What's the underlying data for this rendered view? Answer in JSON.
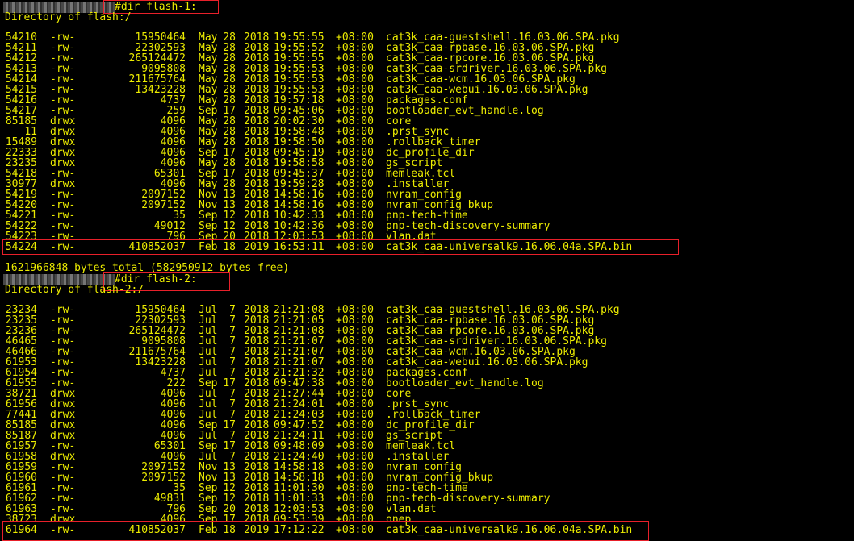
{
  "colors": {
    "background": "#000000",
    "text": "#ecec00",
    "highlight": "#e8202a"
  },
  "block1": {
    "command": "#dir flash-1:",
    "directory": "Directory of flash:/",
    "rows": [
      [
        "54210",
        "-rw-",
        "15950464",
        "May",
        "28",
        "2018",
        "19:55:55",
        "+08:00",
        "cat3k_caa-guestshell.16.03.06.SPA.pkg"
      ],
      [
        "54211",
        "-rw-",
        "22302593",
        "May",
        "28",
        "2018",
        "19:55:52",
        "+08:00",
        "cat3k_caa-rpbase.16.03.06.SPA.pkg"
      ],
      [
        "54212",
        "-rw-",
        "265124472",
        "May",
        "28",
        "2018",
        "19:55:55",
        "+08:00",
        "cat3k_caa-rpcore.16.03.06.SPA.pkg"
      ],
      [
        "54213",
        "-rw-",
        "9095808",
        "May",
        "28",
        "2018",
        "19:55:53",
        "+08:00",
        "cat3k_caa-srdriver.16.03.06.SPA.pkg"
      ],
      [
        "54214",
        "-rw-",
        "211675764",
        "May",
        "28",
        "2018",
        "19:55:53",
        "+08:00",
        "cat3k_caa-wcm.16.03.06.SPA.pkg"
      ],
      [
        "54215",
        "-rw-",
        "13423228",
        "May",
        "28",
        "2018",
        "19:55:53",
        "+08:00",
        "cat3k_caa-webui.16.03.06.SPA.pkg"
      ],
      [
        "54216",
        "-rw-",
        "4737",
        "May",
        "28",
        "2018",
        "19:57:18",
        "+08:00",
        "packages.conf"
      ],
      [
        "54217",
        "-rw-",
        "259",
        "Sep",
        "17",
        "2018",
        "09:45:06",
        "+08:00",
        "bootloader_evt_handle.log"
      ],
      [
        "85185",
        "drwx",
        "4096",
        "May",
        "28",
        "2018",
        "20:02:30",
        "+08:00",
        "core"
      ],
      [
        "11",
        "drwx",
        "4096",
        "May",
        "28",
        "2018",
        "19:58:48",
        "+08:00",
        ".prst_sync"
      ],
      [
        "15489",
        "drwx",
        "4096",
        "May",
        "28",
        "2018",
        "19:58:50",
        "+08:00",
        ".rollback_timer"
      ],
      [
        "22333",
        "drwx",
        "4096",
        "Sep",
        "17",
        "2018",
        "09:45:19",
        "+08:00",
        "dc_profile_dir"
      ],
      [
        "23235",
        "drwx",
        "4096",
        "May",
        "28",
        "2018",
        "19:58:58",
        "+08:00",
        "gs_script"
      ],
      [
        "54218",
        "-rw-",
        "65301",
        "Sep",
        "17",
        "2018",
        "09:45:37",
        "+08:00",
        "memleak.tcl"
      ],
      [
        "30977",
        "drwx",
        "4096",
        "May",
        "28",
        "2018",
        "19:59:28",
        "+08:00",
        ".installer"
      ],
      [
        "54219",
        "-rw-",
        "2097152",
        "Nov",
        "13",
        "2018",
        "14:58:16",
        "+08:00",
        "nvram_config"
      ],
      [
        "54220",
        "-rw-",
        "2097152",
        "Nov",
        "13",
        "2018",
        "14:58:16",
        "+08:00",
        "nvram_config_bkup"
      ],
      [
        "54221",
        "-rw-",
        "35",
        "Sep",
        "12",
        "2018",
        "10:42:33",
        "+08:00",
        "pnp-tech-time"
      ],
      [
        "54222",
        "-rw-",
        "49012",
        "Sep",
        "12",
        "2018",
        "10:42:36",
        "+08:00",
        "pnp-tech-discovery-summary"
      ],
      [
        "54223",
        "-rw-",
        "796",
        "Sep",
        "20",
        "2018",
        "12:03:53",
        "+08:00",
        "vlan.dat"
      ],
      [
        "54224",
        "-rw-",
        "410852037",
        "Feb",
        "18",
        "2019",
        "16:53:11",
        "+08:00",
        "cat3k_caa-universalk9.16.06.04a.SPA.bin"
      ]
    ],
    "total": "1621966848 bytes total (582950912 bytes free)"
  },
  "block2": {
    "command": "#dir flash-2:",
    "directory": "Directory of flash-2:/",
    "rows": [
      [
        "23234",
        "-rw-",
        "15950464",
        "Jul",
        "7",
        "2018",
        "21:21:08",
        "+08:00",
        "cat3k_caa-guestshell.16.03.06.SPA.pkg"
      ],
      [
        "23235",
        "-rw-",
        "22302593",
        "Jul",
        "7",
        "2018",
        "21:21:05",
        "+08:00",
        "cat3k_caa-rpbase.16.03.06.SPA.pkg"
      ],
      [
        "23236",
        "-rw-",
        "265124472",
        "Jul",
        "7",
        "2018",
        "21:21:08",
        "+08:00",
        "cat3k_caa-rpcore.16.03.06.SPA.pkg"
      ],
      [
        "46465",
        "-rw-",
        "9095808",
        "Jul",
        "7",
        "2018",
        "21:21:07",
        "+08:00",
        "cat3k_caa-srdriver.16.03.06.SPA.pkg"
      ],
      [
        "46466",
        "-rw-",
        "211675764",
        "Jul",
        "7",
        "2018",
        "21:21:07",
        "+08:00",
        "cat3k_caa-wcm.16.03.06.SPA.pkg"
      ],
      [
        "61953",
        "-rw-",
        "13423228",
        "Jul",
        "7",
        "2018",
        "21:21:07",
        "+08:00",
        "cat3k_caa-webui.16.03.06.SPA.pkg"
      ],
      [
        "61954",
        "-rw-",
        "4737",
        "Jul",
        "7",
        "2018",
        "21:21:32",
        "+08:00",
        "packages.conf"
      ],
      [
        "61955",
        "-rw-",
        "222",
        "Sep",
        "17",
        "2018",
        "09:47:38",
        "+08:00",
        "bootloader_evt_handle.log"
      ],
      [
        "38721",
        "drwx",
        "4096",
        "Jul",
        "7",
        "2018",
        "21:27:44",
        "+08:00",
        "core"
      ],
      [
        "61956",
        "drwx",
        "4096",
        "Jul",
        "7",
        "2018",
        "21:24:01",
        "+08:00",
        ".prst_sync"
      ],
      [
        "77441",
        "drwx",
        "4096",
        "Jul",
        "7",
        "2018",
        "21:24:03",
        "+08:00",
        ".rollback_timer"
      ],
      [
        "85185",
        "drwx",
        "4096",
        "Sep",
        "17",
        "2018",
        "09:47:52",
        "+08:00",
        "dc_profile_dir"
      ],
      [
        "85187",
        "drwx",
        "4096",
        "Jul",
        "7",
        "2018",
        "21:24:11",
        "+08:00",
        "gs_script"
      ],
      [
        "61957",
        "-rw-",
        "65301",
        "Sep",
        "17",
        "2018",
        "09:48:09",
        "+08:00",
        "memleak.tcl"
      ],
      [
        "61958",
        "drwx",
        "4096",
        "Jul",
        "7",
        "2018",
        "21:24:40",
        "+08:00",
        ".installer"
      ],
      [
        "61959",
        "-rw-",
        "2097152",
        "Nov",
        "13",
        "2018",
        "14:58:18",
        "+08:00",
        "nvram_config"
      ],
      [
        "61960",
        "-rw-",
        "2097152",
        "Nov",
        "13",
        "2018",
        "14:58:18",
        "+08:00",
        "nvram_config_bkup"
      ],
      [
        "61961",
        "-rw-",
        "35",
        "Sep",
        "12",
        "2018",
        "11:01:30",
        "+08:00",
        "pnp-tech-time"
      ],
      [
        "61962",
        "-rw-",
        "49831",
        "Sep",
        "12",
        "2018",
        "11:01:33",
        "+08:00",
        "pnp-tech-discovery-summary"
      ],
      [
        "61963",
        "-rw-",
        "796",
        "Sep",
        "20",
        "2018",
        "12:03:53",
        "+08:00",
        "vlan.dat"
      ],
      [
        "38723",
        "drwx",
        "4096",
        "Sep",
        "17",
        "2018",
        "09:53:39",
        "+08:00",
        "onep"
      ],
      [
        "61964",
        "-rw-",
        "410852037",
        "Feb",
        "18",
        "2019",
        "17:12:22",
        "+08:00",
        "cat3k_caa-universalk9.16.06.04a.SPA.bin"
      ]
    ]
  }
}
